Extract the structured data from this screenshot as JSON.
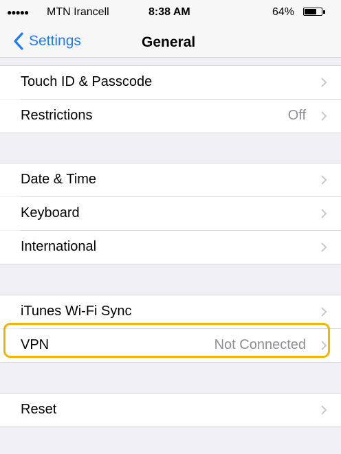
{
  "status_bar": {
    "signal": "●●●●●",
    "carrier": "MTN Irancell",
    "time": "8:38 AM",
    "battery_text": "64%",
    "battery_level": 0.64
  },
  "nav": {
    "back_label": "Settings",
    "title": "General"
  },
  "rows": [
    {
      "label": "Touch ID & Passcode",
      "value": ""
    },
    {
      "label": "Restrictions",
      "value": "Off"
    },
    {
      "label": "Date & Time",
      "value": ""
    },
    {
      "label": "Keyboard",
      "value": ""
    },
    {
      "label": "International",
      "value": ""
    },
    {
      "label": "iTunes Wi-Fi Sync",
      "value": ""
    },
    {
      "label": "VPN",
      "value": "Not Connected"
    },
    {
      "label": "Reset",
      "value": ""
    }
  ],
  "colors": {
    "accent": "#1a7cff",
    "highlight": "#f4b400"
  },
  "icons": {
    "back": "chevron-left-icon",
    "row": "chevron-right-icon"
  }
}
